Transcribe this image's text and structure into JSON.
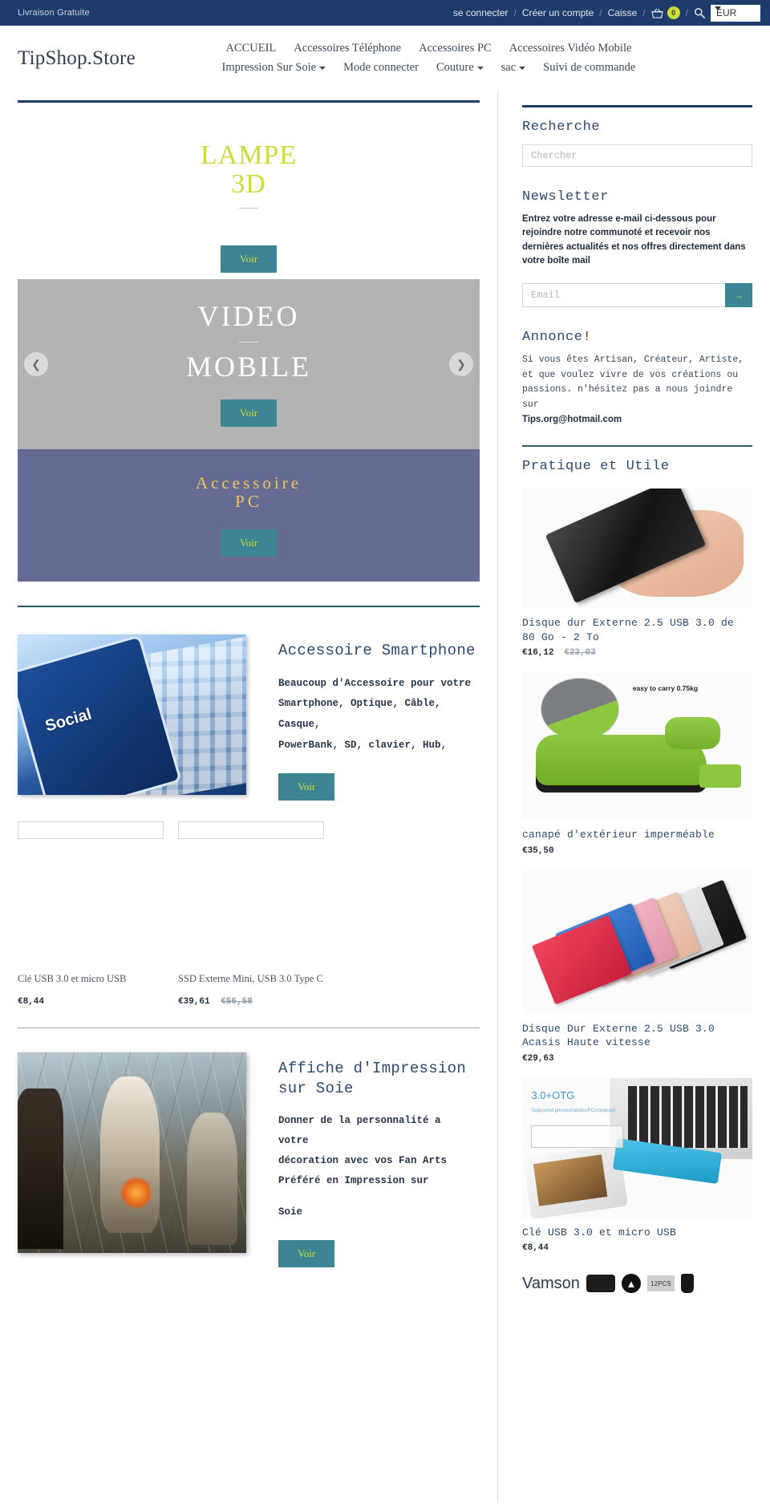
{
  "topbar": {
    "promo": "Livraison Gratuite",
    "login": "se connecter",
    "register": "Créer un compte",
    "checkout": "Caisse",
    "cart_count": "0",
    "currency": "EUR",
    "separator": "/"
  },
  "header": {
    "brand": "TipShop.Store",
    "nav_row1": [
      {
        "label": "ACCUEIL",
        "has_caret": false
      },
      {
        "label": "Accessoires Téléphone",
        "has_caret": false
      },
      {
        "label": "Accessoires PC",
        "has_caret": false
      },
      {
        "label": "Accessoires Vidéo Mobile",
        "has_caret": false
      }
    ],
    "nav_row2": [
      {
        "label": "Impression Sur Soie",
        "has_caret": true
      },
      {
        "label": "Mode connecter",
        "has_caret": false
      },
      {
        "label": "Couture",
        "has_caret": true
      },
      {
        "label": "sac",
        "has_caret": true
      },
      {
        "label": "Suivi de commande",
        "has_caret": false
      }
    ]
  },
  "slides": [
    {
      "title_line1": "LAMPE",
      "title_line2": "3D",
      "cta": "Voir"
    },
    {
      "title_line1": "VIDEO",
      "title_line2": "MOBILE",
      "cta": "Voir"
    },
    {
      "title_line1": "Accessoire",
      "title_line2": "PC",
      "cta": "Voir"
    }
  ],
  "features": [
    {
      "title": "Accessoire Smartphone",
      "body_lines": [
        "Beaucoup d'Accessoire pour votre",
        "Smartphone, Optique, Câble, Casque,",
        "PowerBank, SD, clavier, Hub,"
      ],
      "cta": "Voir",
      "image_caption": "Social"
    },
    {
      "title_line1": "Affiche d'Impression",
      "title_line2": "sur Soie",
      "body_lines": [
        "Donner de la personnalité a votre",
        "décoration avec vos Fan Arts",
        "Préféré en Impression sur"
      ],
      "body_tail": "Soie",
      "cta": "Voir"
    }
  ],
  "products": [
    {
      "name": "Clé USB 3.0 et micro USB",
      "price": "€8,44",
      "old_price": ""
    },
    {
      "name": "SSD Externe Mini, USB 3.0 Type C",
      "price": "€39,61",
      "old_price": "€56,58"
    }
  ],
  "aside": {
    "search": {
      "heading": "Recherche",
      "placeholder": "Chercher"
    },
    "newsletter": {
      "heading": "Newsletter",
      "description": "Entrez votre adresse e-mail ci-dessous pour rejoindre notre communoté et recevoir nos dernières actualités et nos offres directement dans votre boîte mail",
      "placeholder": "Email",
      "submit_glyph": "→"
    },
    "announce": {
      "heading": "Annonce!",
      "body": "Si vous êtes Artisan, Créateur, Artiste, et que voulez vivre de vos créations ou passions. n'hésitez pas a nous joindre sur",
      "email": "Tips.org@hotmail.com"
    },
    "useful": {
      "heading": "Pratique et Utile",
      "items": [
        {
          "name": "Disque dur Externe 2.5 USB 3.0 de 80 Go - 2 To",
          "price": "€16,12",
          "old_price": "€23,03"
        },
        {
          "name": "canapé d'extérieur imperméable",
          "price": "€35,50",
          "old_price": "",
          "badge": "easy to carry 0.75kg"
        },
        {
          "name": "Disque Dur Externe 2.5 USB 3.0 Acasis Haute vitesse",
          "price": "€29,63",
          "old_price": ""
        },
        {
          "name": "Clé USB 3.0 et micro USB",
          "price": "€8,44",
          "old_price": "",
          "overlay_title": "3.0+OTG",
          "overlay_sub": "Supported phones/tablets/PC/computer"
        }
      ],
      "next_brand": "Vamson",
      "next_badge": "12PCS"
    }
  },
  "colors": {
    "navy": "#1f3b6b",
    "teal": "#3d8494",
    "lime": "#cddc39",
    "gold": "#f1c75c",
    "purple": "#666b93",
    "gray": "#b3b3b3"
  }
}
